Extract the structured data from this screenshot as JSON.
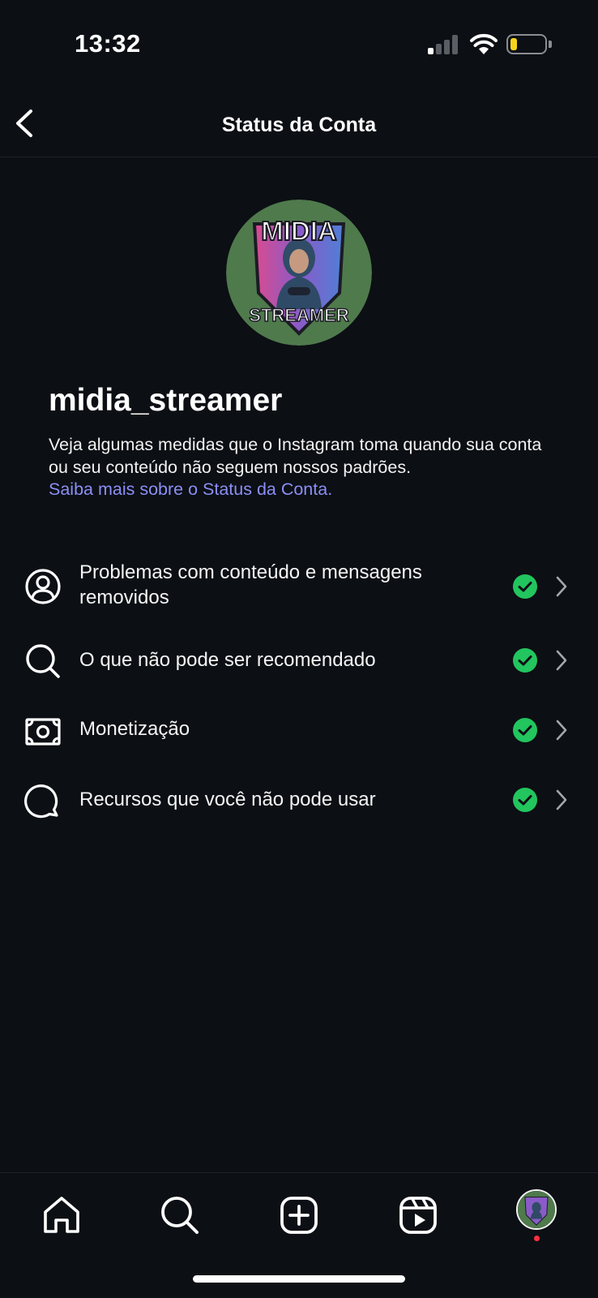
{
  "status_bar": {
    "time": "13:32",
    "battery_level": 0.2
  },
  "header": {
    "title": "Status da Conta",
    "back_icon": "chevron-left-icon"
  },
  "profile": {
    "username": "midia_streamer",
    "avatar_text_top": "MIDIA",
    "avatar_text_bottom": "STREAMER",
    "description": "Veja algumas medidas que o Instagram toma quando sua conta ou seu conteúdo não seguem nossos padrões.",
    "link_text": "Saiba mais sobre o Status da Conta."
  },
  "status_items": [
    {
      "label": "Problemas com conteúdo e mensagens removidos",
      "icon": "user-circle-icon",
      "status": "ok"
    },
    {
      "label": "O que não pode ser recomendado",
      "icon": "search-icon",
      "status": "ok"
    },
    {
      "label": "Monetização",
      "icon": "money-icon",
      "status": "ok"
    },
    {
      "label": "Recursos que você não pode usar",
      "icon": "chat-bubble-icon",
      "status": "ok"
    }
  ],
  "colors": {
    "background": "#0c0f14",
    "link": "#8b8ff5",
    "check": "#22c55e",
    "notification_dot": "#ff3040",
    "battery": "#f8d51a"
  },
  "bottom_nav": {
    "items": [
      "home-icon",
      "search-icon",
      "create-icon",
      "reels-icon",
      "profile-avatar"
    ]
  }
}
